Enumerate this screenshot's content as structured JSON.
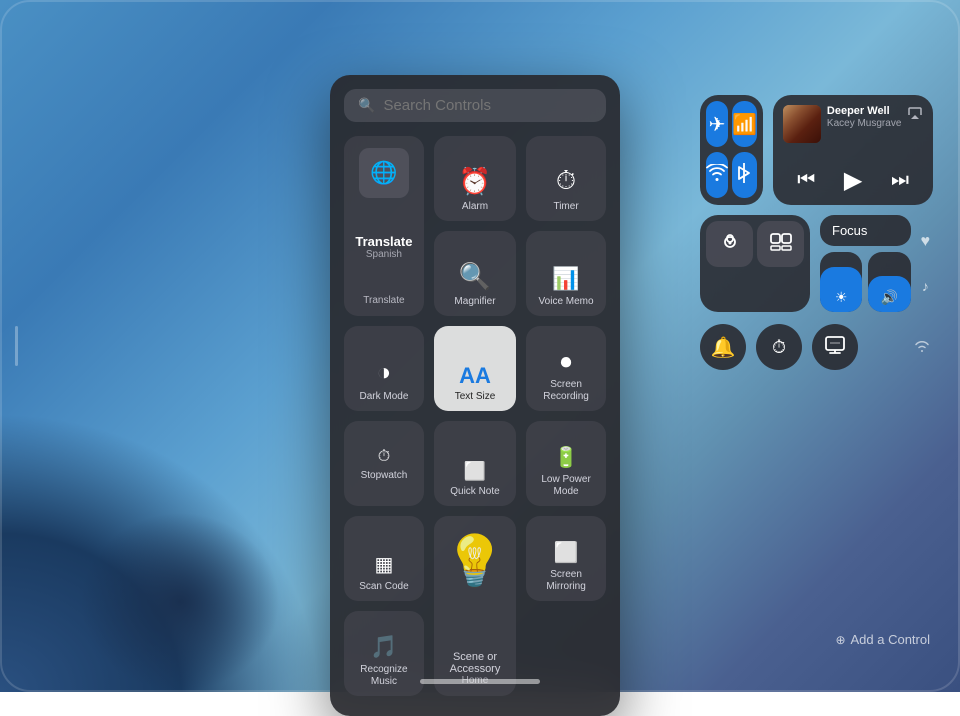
{
  "wallpaper": {
    "bg": "gradient"
  },
  "search_panel": {
    "search_placeholder": "Search Controls",
    "controls": [
      {
        "id": "translate",
        "label": "Translate",
        "sublabel": "Spanish",
        "bottom_label": "Translate",
        "icon": "🌐",
        "type": "large"
      },
      {
        "id": "alarm",
        "label": "Alarm",
        "icon": "⏰"
      },
      {
        "id": "timer",
        "label": "Timer",
        "icon": "⏱"
      },
      {
        "id": "magnifier",
        "label": "Magnifier",
        "icon": "🔍"
      },
      {
        "id": "voice_memo",
        "label": "Voice Memo",
        "icon": "🎤"
      },
      {
        "id": "dark_mode",
        "label": "Dark Mode",
        "icon": "◑"
      },
      {
        "id": "text_size",
        "label": "Text Size",
        "icon": "AA",
        "type": "text_size"
      },
      {
        "id": "screen_recording",
        "label": "Screen Recording",
        "icon": "⏺"
      },
      {
        "id": "stopwatch",
        "label": "Stopwatch",
        "icon": "⏱"
      },
      {
        "id": "quick_note",
        "label": "Quick Note",
        "icon": "📋"
      },
      {
        "id": "low_power",
        "label": "Low Power Mode",
        "icon": "🔋"
      },
      {
        "id": "scan_code",
        "label": "Scan Code",
        "icon": "⬛"
      },
      {
        "id": "scene_accessory",
        "label": "Scene or Accessory",
        "sublabel": "Home",
        "icon": "💡",
        "type": "large"
      },
      {
        "id": "screen_mirroring",
        "label": "Screen Mirroring",
        "icon": "📺"
      },
      {
        "id": "recognize_music",
        "label": "Recognize Music",
        "icon": "🎵"
      }
    ]
  },
  "control_center": {
    "connectivity": {
      "airplane": {
        "active": true,
        "icon": "✈"
      },
      "wifi_calling": {
        "active": true,
        "icon": "📶"
      },
      "wifi": {
        "active": true,
        "icon": "wifi"
      },
      "bluetooth": {
        "active": true,
        "icon": "bluetooth"
      }
    },
    "now_playing": {
      "title": "Deeper Well",
      "artist": "Kacey Musgrave",
      "prev_icon": "⏮",
      "play_icon": "▶",
      "next_icon": "⏭",
      "airplay_icon": "airplay"
    },
    "screen_controls": {
      "lock_rotation": {
        "icon": "🔒"
      },
      "screen_mirror": {
        "icon": "⬜"
      }
    },
    "focus_label": "Focus",
    "sliders": {
      "brightness_fill_pct": 75,
      "volume_fill_pct": 60
    },
    "bottom_controls": [
      {
        "id": "sound",
        "icon": "🔔",
        "active": false
      },
      {
        "id": "stopwatch_cc",
        "icon": "⏱",
        "active": false
      },
      {
        "id": "screen_time",
        "icon": "📱",
        "active": false
      }
    ],
    "side_controls": {
      "heart": "♥",
      "music": "♪",
      "wifi_side": "wifi"
    }
  },
  "add_control": {
    "label": "Add a Control",
    "icon": "+"
  },
  "home_indicator": {}
}
